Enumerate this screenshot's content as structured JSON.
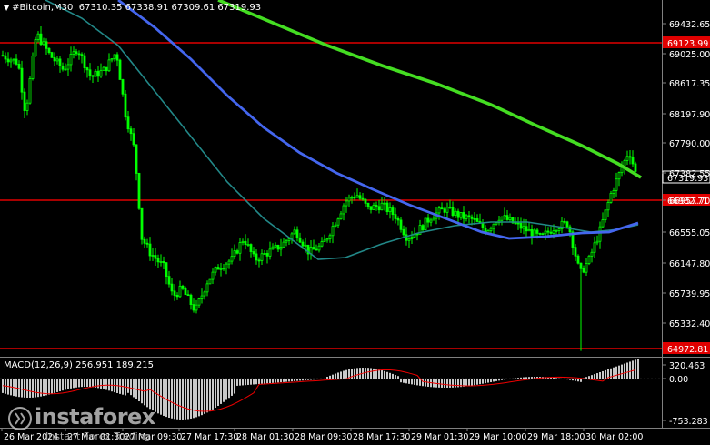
{
  "header": {
    "symbol": "#Bitcoin,M30",
    "ohlc": "67310.35 67338.91 67309.61 67319.93"
  },
  "price_axis": {
    "ticks": [
      "69432.65",
      "69025.00",
      "68617.35",
      "68197.90",
      "67790.00",
      "67382.55",
      "66957.70",
      "66555.05",
      "66147.80",
      "65739.95",
      "65332.40",
      "64924.75"
    ],
    "current_price": "67319.93",
    "levels": [
      {
        "label": "69123.99",
        "color": "#e00000"
      },
      {
        "label": "66982.71",
        "color": "#e00000"
      },
      {
        "label": "64972.81",
        "color": "#e00000"
      }
    ]
  },
  "macd": {
    "label": "MACD(12,26,9) 256.951 189.215",
    "axis_ticks": [
      "320.463",
      "0.00",
      "-753.283"
    ]
  },
  "time_axis": {
    "labels": [
      "26 Mar 2024",
      "27 Mar 01:30",
      "27 Mar 09:30",
      "27 Mar 17:30",
      "28 Mar 01:30",
      "28 Mar 09:30",
      "28 Mar 17:30",
      "29 Mar 01:30",
      "29 Mar 10:00",
      "29 Mar 18:00",
      "30 Mar 02:00"
    ]
  },
  "watermark": {
    "brand": "instaforex",
    "tagline": "Instant Forex Trading"
  },
  "colors": {
    "candle": "#00ff00",
    "ma_slow": "#44dd22",
    "ma_mid": "#4466ee",
    "ma_fast": "#228888",
    "level": "#e00000",
    "macd_hist": "#c8c8c8",
    "macd_signal": "#ee0000"
  }
}
